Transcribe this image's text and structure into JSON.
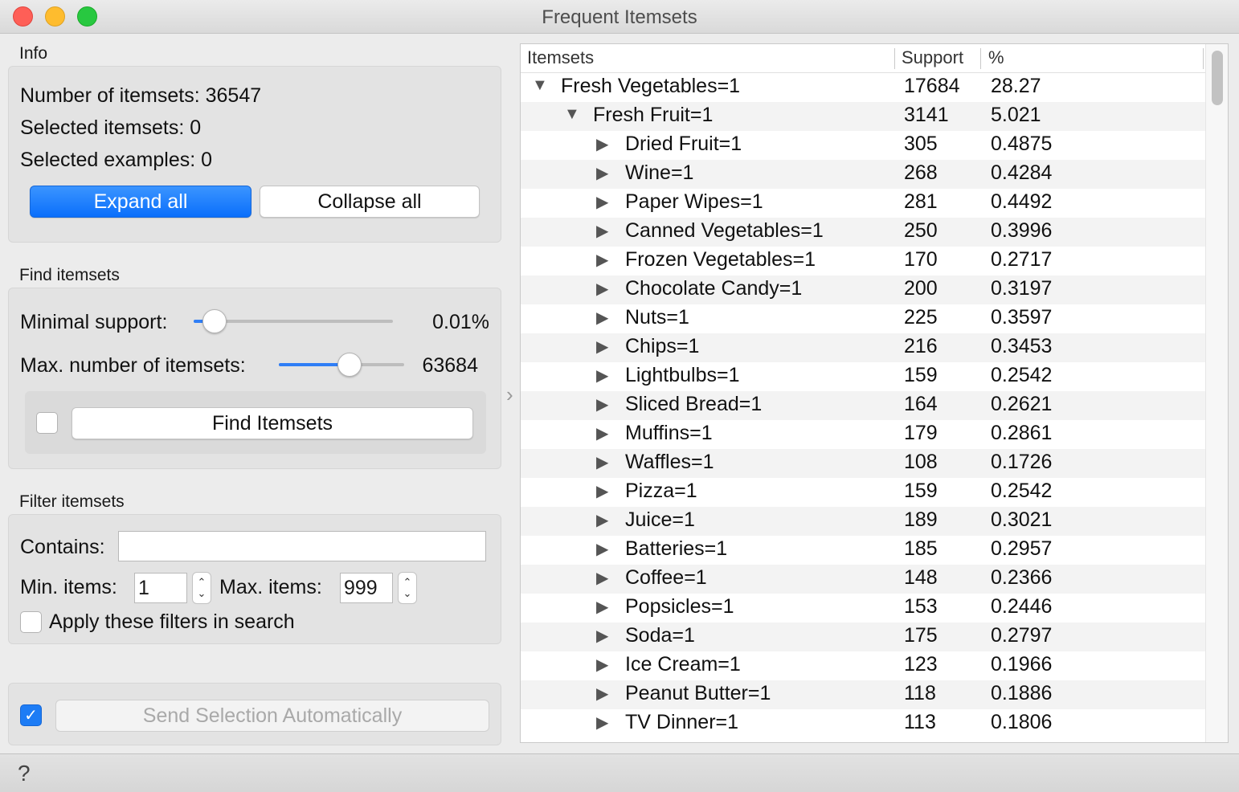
{
  "window": {
    "title": "Frequent Itemsets"
  },
  "info": {
    "section_label": "Info",
    "num_itemsets": "Number of itemsets: 36547",
    "selected_itemsets": "Selected itemsets: 0",
    "selected_examples": "Selected examples: 0",
    "expand_all": "Expand all",
    "collapse_all": "Collapse all"
  },
  "find": {
    "section_label": "Find itemsets",
    "min_support_label": "Minimal support:",
    "min_support_value": "0.01%",
    "min_support_slider_fraction": 0.05,
    "max_itemsets_label": "Max. number of itemsets:",
    "max_itemsets_value": "63684",
    "max_itemsets_slider_fraction": 0.58,
    "auto_find_checked": false,
    "find_button": "Find Itemsets"
  },
  "filter": {
    "section_label": "Filter itemsets",
    "contains_label": "Contains:",
    "contains_value": "",
    "min_items_label": "Min. items:",
    "min_items_value": "1",
    "max_items_label": "Max. items:",
    "max_items_value": "999",
    "apply_label": "Apply these filters in search",
    "apply_checked": false
  },
  "send": {
    "auto_checked": true,
    "button": "Send Selection Automatically"
  },
  "table": {
    "columns": [
      "Itemsets",
      "Support",
      "%"
    ],
    "rows": [
      {
        "level": 0,
        "expanded": true,
        "name": "Fresh Vegetables=1",
        "support": "17684",
        "percent": "28.27"
      },
      {
        "level": 1,
        "expanded": true,
        "name": "Fresh Fruit=1",
        "support": "3141",
        "percent": "5.021"
      },
      {
        "level": 2,
        "expanded": false,
        "name": "Dried Fruit=1",
        "support": "305",
        "percent": "0.4875"
      },
      {
        "level": 2,
        "expanded": false,
        "name": "Wine=1",
        "support": "268",
        "percent": "0.4284"
      },
      {
        "level": 2,
        "expanded": false,
        "name": "Paper Wipes=1",
        "support": "281",
        "percent": "0.4492"
      },
      {
        "level": 2,
        "expanded": false,
        "name": "Canned Vegetables=1",
        "support": "250",
        "percent": "0.3996"
      },
      {
        "level": 2,
        "expanded": false,
        "name": "Frozen Vegetables=1",
        "support": "170",
        "percent": "0.2717"
      },
      {
        "level": 2,
        "expanded": false,
        "name": "Chocolate Candy=1",
        "support": "200",
        "percent": "0.3197"
      },
      {
        "level": 2,
        "expanded": false,
        "name": "Nuts=1",
        "support": "225",
        "percent": "0.3597"
      },
      {
        "level": 2,
        "expanded": false,
        "name": "Chips=1",
        "support": "216",
        "percent": "0.3453"
      },
      {
        "level": 2,
        "expanded": false,
        "name": "Lightbulbs=1",
        "support": "159",
        "percent": "0.2542"
      },
      {
        "level": 2,
        "expanded": false,
        "name": "Sliced Bread=1",
        "support": "164",
        "percent": "0.2621"
      },
      {
        "level": 2,
        "expanded": false,
        "name": "Muffins=1",
        "support": "179",
        "percent": "0.2861"
      },
      {
        "level": 2,
        "expanded": false,
        "name": "Waffles=1",
        "support": "108",
        "percent": "0.1726"
      },
      {
        "level": 2,
        "expanded": false,
        "name": "Pizza=1",
        "support": "159",
        "percent": "0.2542"
      },
      {
        "level": 2,
        "expanded": false,
        "name": "Juice=1",
        "support": "189",
        "percent": "0.3021"
      },
      {
        "level": 2,
        "expanded": false,
        "name": "Batteries=1",
        "support": "185",
        "percent": "0.2957"
      },
      {
        "level": 2,
        "expanded": false,
        "name": "Coffee=1",
        "support": "148",
        "percent": "0.2366"
      },
      {
        "level": 2,
        "expanded": false,
        "name": "Popsicles=1",
        "support": "153",
        "percent": "0.2446"
      },
      {
        "level": 2,
        "expanded": false,
        "name": "Soda=1",
        "support": "175",
        "percent": "0.2797"
      },
      {
        "level": 2,
        "expanded": false,
        "name": "Ice Cream=1",
        "support": "123",
        "percent": "0.1966"
      },
      {
        "level": 2,
        "expanded": false,
        "name": "Peanut Butter=1",
        "support": "118",
        "percent": "0.1886"
      },
      {
        "level": 2,
        "expanded": false,
        "name": "TV Dinner=1",
        "support": "113",
        "percent": "0.1806"
      }
    ]
  },
  "icons": {
    "expanded": "triangle-down-icon",
    "collapsed": "triangle-right-icon",
    "help": "question-mark-icon",
    "panel_toggle": "chevron-right-icon"
  }
}
